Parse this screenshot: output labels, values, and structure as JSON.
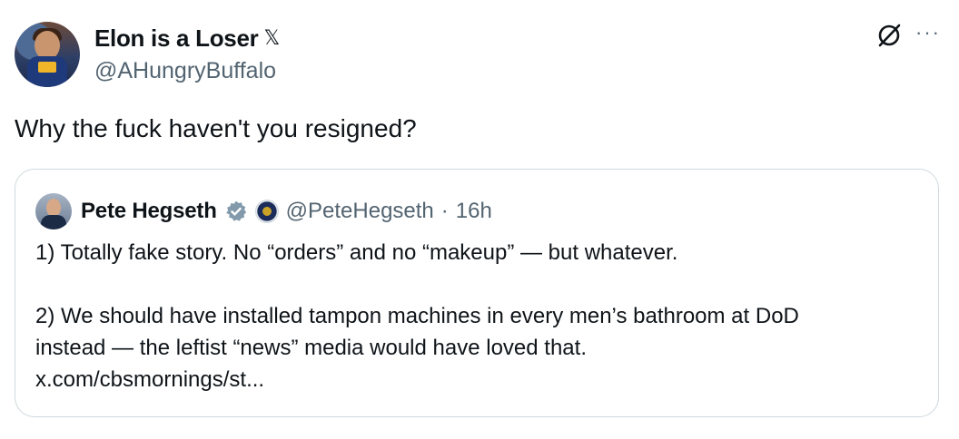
{
  "author": {
    "display_name": "Elon is a Loser",
    "badge": "𝕏",
    "handle": "@AHungryBuffalo"
  },
  "actions": {
    "grok_icon": "grok-icon",
    "more_label": "···"
  },
  "tweet": {
    "text": "Why the fuck haven't you resigned?"
  },
  "quoted_tweet": {
    "display_name": "Pete Hegseth",
    "handle": "@PeteHegseth",
    "separator": "·",
    "time": "16h",
    "paragraph_1": "1) Totally fake story. No “orders” and no “makeup” — but whatever.",
    "paragraph_2_line_1": "2) We should have installed tampon machines in every men’s bathroom at DoD",
    "paragraph_2_line_2": "instead — the leftist “news” media would have loved that.",
    "link": "x.com/cbsmornings/st..."
  },
  "colors": {
    "verified": "#829aab",
    "text": "#0f1419",
    "muted": "#536471",
    "border": "#cfd9de"
  }
}
